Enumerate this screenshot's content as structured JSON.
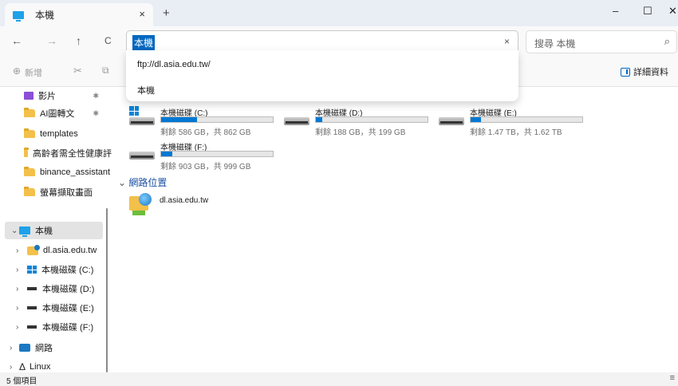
{
  "window": {
    "tab_title": "本機",
    "tab_close": "×",
    "new_tab": "+",
    "minimize": "–",
    "maximize": "☐",
    "close": "✕"
  },
  "nav": {
    "back": "←",
    "forward": "→",
    "up": "↑",
    "refresh": "C",
    "address_value": "本機",
    "address_clear": "×",
    "search_placeholder": "搜尋 本機",
    "search_icon": "⌕"
  },
  "dropdown": {
    "items": [
      "ftp://dl.asia.edu.tw/",
      "本機"
    ]
  },
  "cmdbar": {
    "new_label": "新增",
    "new_icon": "⊕",
    "cut_icon": "✂",
    "copy_icon": "⧉",
    "details_label": "詳細資料"
  },
  "sidebar": {
    "quick": [
      {
        "label": "影片",
        "pinned": true
      },
      {
        "label": "AI圖轉文",
        "pinned": true
      },
      {
        "label": "templates",
        "pinned": false
      },
      {
        "label": "高齡者需全性健康評",
        "pinned": false
      },
      {
        "label": "binance_assistant",
        "pinned": false
      },
      {
        "label": "螢幕擷取畫面",
        "pinned": false
      }
    ],
    "this_pc": "本機",
    "tree": [
      {
        "label": "dl.asia.edu.tw"
      },
      {
        "label": "本機磁碟 (C:)"
      },
      {
        "label": "本機磁碟 (D:)"
      },
      {
        "label": "本機磁碟 (E:)"
      },
      {
        "label": "本機磁碟 (F:)"
      }
    ],
    "network": "網路",
    "linux": "Linux",
    "pin_glyph": "✱",
    "chevron_right": "›",
    "chevron_down": "⌄"
  },
  "main": {
    "drives": [
      {
        "name": "本機磁碟 (C:)",
        "free": "剩餘 586 GB，共 862 GB",
        "used_fraction": 0.32
      },
      {
        "name": "本機磁碟 (D:)",
        "free": "剩餘 188 GB，共 199 GB",
        "used_fraction": 0.06
      },
      {
        "name": "本機磁碟 (E:)",
        "free": "剩餘 1.47 TB，共 1.62 TB",
        "used_fraction": 0.09
      },
      {
        "name": "本機磁碟 (F:)",
        "free": "剩餘 903 GB，共 999 GB",
        "used_fraction": 0.1
      }
    ],
    "network_section": "網路位置",
    "network_locations": [
      {
        "label": "dl.asia.edu.tw"
      }
    ]
  },
  "status": {
    "item_count": "5 個項目",
    "view_icon": "≡"
  },
  "colors": {
    "accent": "#0067c0",
    "bar_fill": "#0078d4"
  }
}
